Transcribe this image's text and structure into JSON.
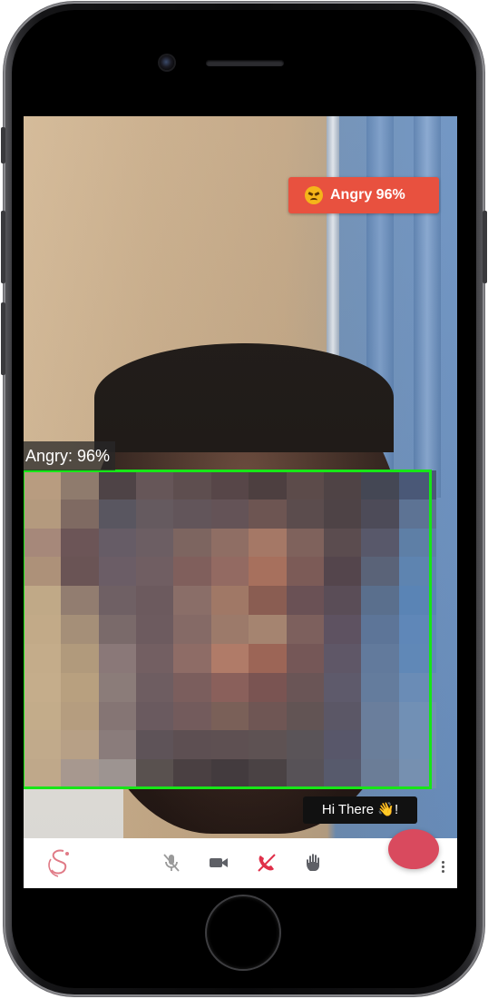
{
  "video": {
    "emotion_badge": "Angry 96%",
    "face_label": "Angry: 96%",
    "chat_message": "Hi There 👋!"
  },
  "toolbar": {
    "items": [
      {
        "icon": "logo-icon"
      },
      {
        "icon": "mic-off-icon"
      },
      {
        "icon": "video-camera-icon"
      },
      {
        "icon": "end-call-icon"
      },
      {
        "icon": "raise-hand-icon"
      },
      {
        "icon": "chat-fab"
      },
      {
        "icon": "more-vertical-icon"
      }
    ]
  },
  "colors": {
    "badge": "#e8513f",
    "face_box": "#17e617",
    "end_call": "#e0304a",
    "fab": "#d94a5e"
  }
}
